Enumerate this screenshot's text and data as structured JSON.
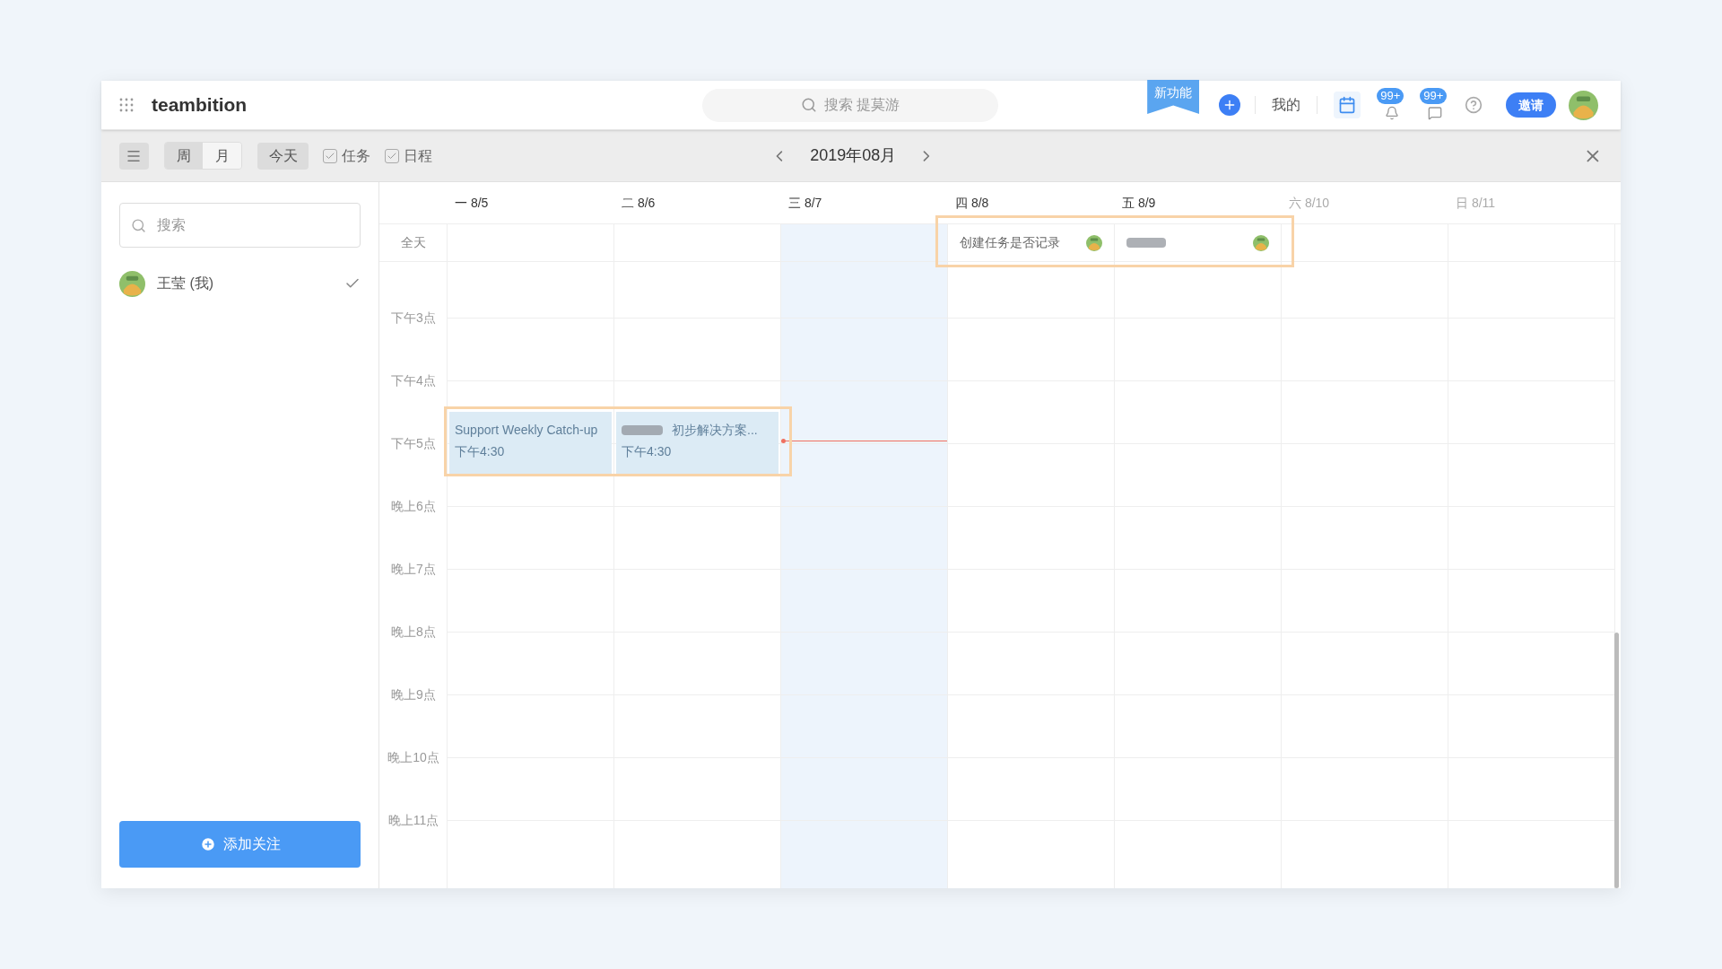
{
  "header": {
    "brand": "teambition",
    "search_placeholder": "搜索 提莫游",
    "new_feature": "新功能",
    "mine": "我的",
    "notifications": "99+",
    "messages": "99+",
    "invite": "邀请"
  },
  "toolbar": {
    "views": [
      {
        "label": "周",
        "selected": true
      },
      {
        "label": "月",
        "selected": false
      }
    ],
    "today": "今天",
    "filters": [
      {
        "label": "任务",
        "checked": true
      },
      {
        "label": "日程",
        "checked": true
      }
    ],
    "month": "2019年08月"
  },
  "sidebar": {
    "search_placeholder": "搜索",
    "members": [
      {
        "name": "王莹 (我)",
        "checked": true
      }
    ],
    "add_button": "添加关注"
  },
  "calendar": {
    "all_day_label": "全天",
    "hours": [
      "下午3点",
      "下午4点",
      "下午5点",
      "晚上6点",
      "晚上7点",
      "晚上8点",
      "晚上9点",
      "晚上10点",
      "晚上11点"
    ],
    "days": [
      {
        "label": "一 8/5",
        "weekend": false,
        "highlighted": false,
        "events": [
          {
            "title": "Support Weekly Catch-up",
            "time": "下午4:30",
            "redacted": false
          }
        ]
      },
      {
        "label": "二 8/6",
        "weekend": false,
        "highlighted": false,
        "events": [
          {
            "title": "初步解决方案...",
            "time": "下午4:30",
            "redacted": true
          }
        ]
      },
      {
        "label": "三 8/7",
        "weekend": false,
        "highlighted": true,
        "current_time": true
      },
      {
        "label": "四 8/8",
        "weekend": false,
        "highlighted": false,
        "all_day_events": [
          {
            "title": "创建任务是否记录",
            "redacted": false
          }
        ]
      },
      {
        "label": "五 8/9",
        "weekend": false,
        "highlighted": false,
        "all_day_events": [
          {
            "redacted": true
          }
        ]
      },
      {
        "label": "六 8/10",
        "weekend": true,
        "highlighted": false
      },
      {
        "label": "日 8/11",
        "weekend": true,
        "highlighted": false
      }
    ]
  }
}
